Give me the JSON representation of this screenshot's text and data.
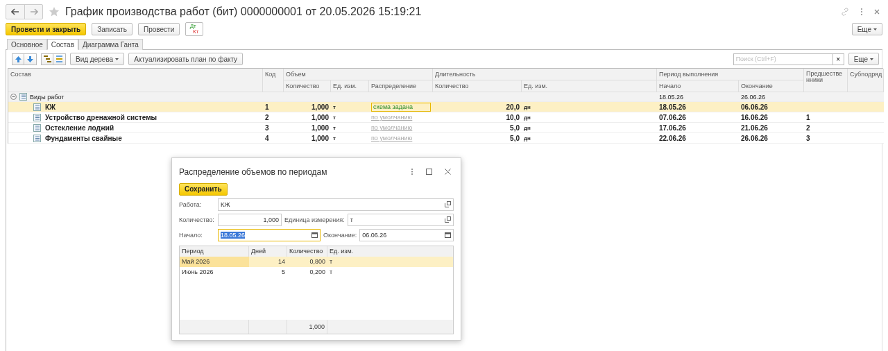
{
  "window": {
    "title": "График производства работ (бит) 0000000001 от 20.05.2026 15:19:21"
  },
  "command_bar": {
    "buttons": [
      {
        "label": "Провести и закрыть",
        "kind": "primary"
      },
      {
        "label": "Записать",
        "kind": "normal"
      },
      {
        "label": "Провести",
        "kind": "normal"
      }
    ],
    "dt_kt": [
      "Дт",
      "Кт"
    ],
    "more": "Еще"
  },
  "tabs": [
    {
      "label": "Основное",
      "selected": false
    },
    {
      "label": "Состав",
      "selected": true
    },
    {
      "label": "Диаграмма Ганта",
      "selected": false
    }
  ],
  "table_toolbar": {
    "tree_view": "Вид дерева",
    "update_plan": "Актуализировать план по факту",
    "search": {
      "placeholder": "Поиск (Ctrl+F)"
    },
    "clear": "×",
    "more": "Еще"
  },
  "table": {
    "headers": {
      "name": "Состав",
      "code": "Код",
      "volume": "Объем",
      "volume_qty": "Количество",
      "volume_unit": "Ед. изм.",
      "distribution": "Распределение",
      "duration": "Длительность",
      "duration_qty": "Количество",
      "duration_unit": "Ед. изм.",
      "period": "Период выполнения",
      "start": "Начало",
      "end": "Окончание",
      "predecessors": "Предшественники",
      "subcontract": "Субподряд"
    },
    "group": {
      "name": "Виды работ",
      "expanded": true,
      "start": "18.05.26",
      "end": "26.06.26"
    },
    "rows": [
      {
        "name": "КЖ",
        "code": "1",
        "qty": "1,000",
        "unit": "т",
        "distribution": {
          "text": "схема задана",
          "kind": "set"
        },
        "duration": "20,0",
        "duration_unit": "дн",
        "start": "18.05.26",
        "end": "06.06.26",
        "predecessor": "",
        "selected": true
      },
      {
        "name": "Устройство дренажной системы",
        "code": "2",
        "qty": "1,000",
        "unit": "т",
        "distribution": {
          "text": "по умолчанию",
          "kind": "default"
        },
        "duration": "10,0",
        "duration_unit": "дн",
        "start": "07.06.26",
        "end": "16.06.26",
        "predecessor": "1",
        "selected": false
      },
      {
        "name": "Остекление лоджий",
        "code": "3",
        "qty": "1,000",
        "unit": "т",
        "distribution": {
          "text": "по умолчанию",
          "kind": "default"
        },
        "duration": "5,0",
        "duration_unit": "дн",
        "start": "17.06.26",
        "end": "21.06.26",
        "predecessor": "2",
        "selected": false
      },
      {
        "name": "Фундаменты свайные",
        "code": "4",
        "qty": "1,000",
        "unit": "т",
        "distribution": {
          "text": "по умолчанию",
          "kind": "default"
        },
        "duration": "5,0",
        "duration_unit": "дн",
        "start": "22.06.26",
        "end": "26.06.26",
        "predecessor": "3",
        "selected": false
      }
    ]
  },
  "dialog": {
    "title": "Распределение объемов по периодам",
    "save": "Сохранить",
    "work": {
      "label": "Работа:",
      "value": "КЖ"
    },
    "quantity": {
      "label": "Количество:",
      "value": "1,000"
    },
    "unit": {
      "label": "Единица измерения:",
      "value": "т"
    },
    "start": {
      "label": "Начало:",
      "value": "18.05.26",
      "focused": true
    },
    "end": {
      "label": "Окончание:",
      "value": "06.06.26",
      "focused": false
    },
    "columns": [
      "Период",
      "Дней",
      "Количество",
      "Ед. изм."
    ],
    "periods": [
      {
        "period": "Май 2026",
        "days": "14",
        "qty": "0,800",
        "unit": "т",
        "selected": true
      },
      {
        "period": "Июнь 2026",
        "days": "5",
        "qty": "0,200",
        "unit": "т",
        "selected": false
      }
    ],
    "total": "1,000"
  }
}
